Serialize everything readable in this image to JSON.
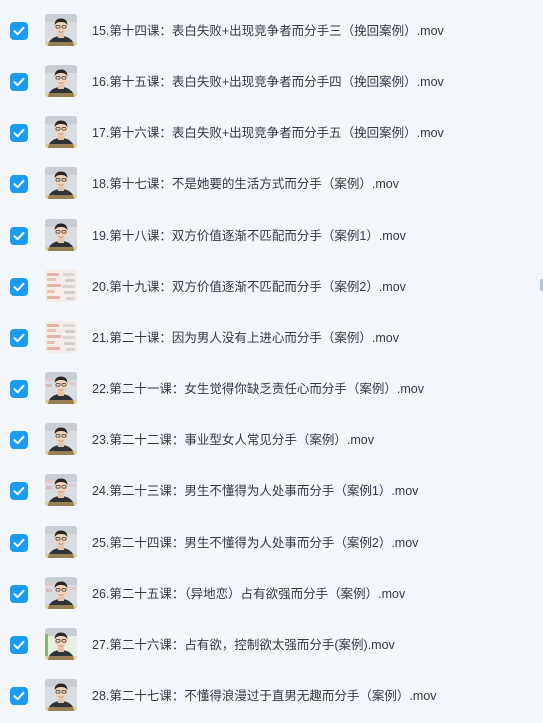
{
  "files": [
    {
      "name": "15.第十四课：表白失败+出现竞争者而分手三（挽回案例）.mov",
      "checked": true,
      "thumb": "person"
    },
    {
      "name": "16.第十五课：表白失败+出现竞争者而分手四（挽回案例）.mov",
      "checked": true,
      "thumb": "person"
    },
    {
      "name": "17.第十六课：表白失败+出现竞争者而分手五（挽回案例）.mov",
      "checked": true,
      "thumb": "person"
    },
    {
      "name": "18.第十七课：不是她要的生活方式而分手（案例）.mov",
      "checked": true,
      "thumb": "person"
    },
    {
      "name": "19.第十八课：双方价值逐渐不匹配而分手（案例1）.mov",
      "checked": true,
      "thumb": "person"
    },
    {
      "name": "20.第十九课：双方价值逐渐不匹配而分手（案例2）.mov",
      "checked": true,
      "thumb": "chat"
    },
    {
      "name": "21.第二十课：因为男人没有上进心而分手（案例）.mov",
      "checked": true,
      "thumb": "chat"
    },
    {
      "name": "22.第二十一课：女生觉得你缺乏责任心而分手（案例）.mov",
      "checked": true,
      "thumb": "person-chat"
    },
    {
      "name": "23.第二十二课：事业型女人常见分手（案例）.mov",
      "checked": true,
      "thumb": "person"
    },
    {
      "name": "24.第二十三课：男生不懂得为人处事而分手（案例1）.mov",
      "checked": true,
      "thumb": "person-chat"
    },
    {
      "name": "25.第二十四课：男生不懂得为人处事而分手（案例2）.mov",
      "checked": true,
      "thumb": "person"
    },
    {
      "name": "26.第二十五课：（异地恋）占有欲强而分手（案例）.mov",
      "checked": true,
      "thumb": "person-chat"
    },
    {
      "name": "27.第二十六课：占有欲，控制欲太强而分手(案例).mov",
      "checked": true,
      "thumb": "person-green"
    },
    {
      "name": "28.第二十七课：不懂得浪漫过于直男无趣而分手（案例）.mov",
      "checked": true,
      "thumb": "person"
    }
  ],
  "colors": {
    "background": "#f3f7fb",
    "checkbox": "#1a9cf2",
    "text": "#333a44"
  },
  "icons": {
    "checkbox": "check-icon",
    "thumbnail": "video-thumbnail"
  }
}
